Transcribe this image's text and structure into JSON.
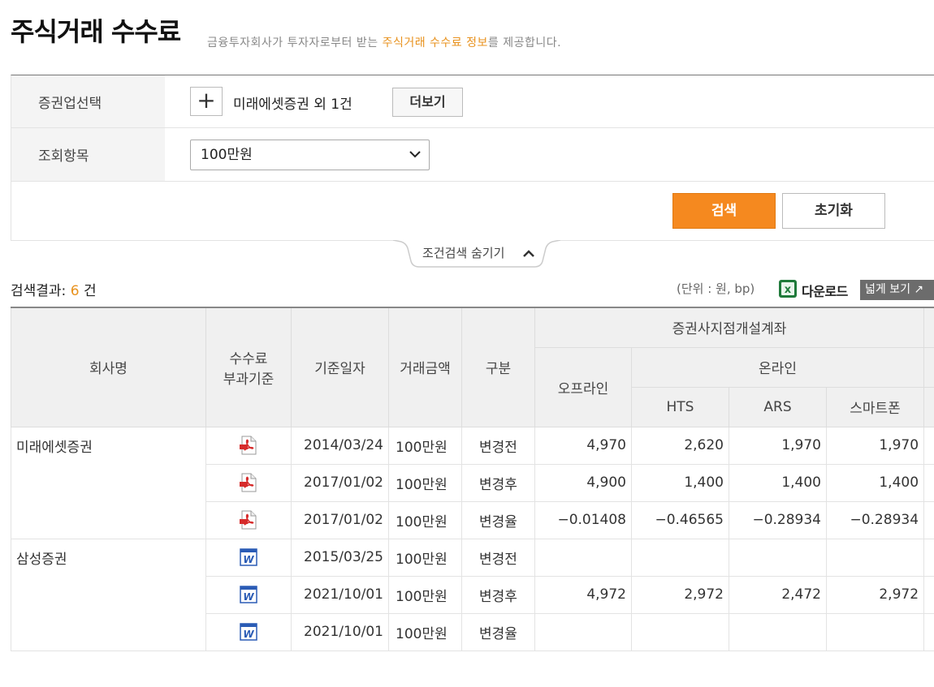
{
  "page": {
    "title": "주식거래 수수료",
    "subtitle_pre": "금융투자회사가 투자자로부터 받는 ",
    "subtitle_highlight": "주식거래 수수료 정보",
    "subtitle_post": "를 제공합니다."
  },
  "filters": {
    "firm_label": "증권업선택",
    "firm_add_symbol": "+",
    "firm_selected": "미래에셋증권 외 1건",
    "more_button": "더보기",
    "item_label": "조회항목",
    "item_value": "100만원",
    "search_button": "검색",
    "reset_button": "초기화",
    "toggle_label": "조건검색 숨기기"
  },
  "results": {
    "label": "검색결과:",
    "count": "6",
    "count_unit": "건",
    "unit_text": "(단위 : 원, bp)",
    "download": "다운로드",
    "wide_view": "넓게 보기 ↗"
  },
  "table": {
    "headers": {
      "company": "회사명",
      "fee_basis_line1": "수수료",
      "fee_basis_line2": "부과기준",
      "date": "기준일자",
      "amount": "거래금액",
      "category": "구분",
      "group": "증권사지점개설계좌",
      "offline": "오프라인",
      "online": "온라인",
      "hts": "HTS",
      "ars": "ARS",
      "smartphone": "스마트폰"
    },
    "groups": [
      {
        "company": "미래에셋증권",
        "doc_type": "pdf-icon",
        "rows": [
          {
            "date": "2014/03/24",
            "amount": "100만원",
            "category": "변경전",
            "offline": "4,970",
            "hts": "2,620",
            "ars": "1,970",
            "smartphone": "1,970"
          },
          {
            "date": "2017/01/02",
            "amount": "100만원",
            "category": "변경후",
            "offline": "4,900",
            "hts": "1,400",
            "ars": "1,400",
            "smartphone": "1,400"
          },
          {
            "date": "2017/01/02",
            "amount": "100만원",
            "category": "변경율",
            "offline": "−0.01408",
            "hts": "−0.46565",
            "ars": "−0.28934",
            "smartphone": "−0.28934"
          }
        ]
      },
      {
        "company": "삼성증권",
        "doc_type": "word-icon",
        "rows": [
          {
            "date": "2015/03/25",
            "amount": "100만원",
            "category": "변경전",
            "offline": "",
            "hts": "",
            "ars": "",
            "smartphone": ""
          },
          {
            "date": "2021/10/01",
            "amount": "100만원",
            "category": "변경후",
            "offline": "4,972",
            "hts": "2,972",
            "ars": "2,472",
            "smartphone": "2,972"
          },
          {
            "date": "2021/10/01",
            "amount": "100만원",
            "category": "변경율",
            "offline": "",
            "hts": "",
            "ars": "",
            "smartphone": ""
          }
        ]
      }
    ]
  }
}
